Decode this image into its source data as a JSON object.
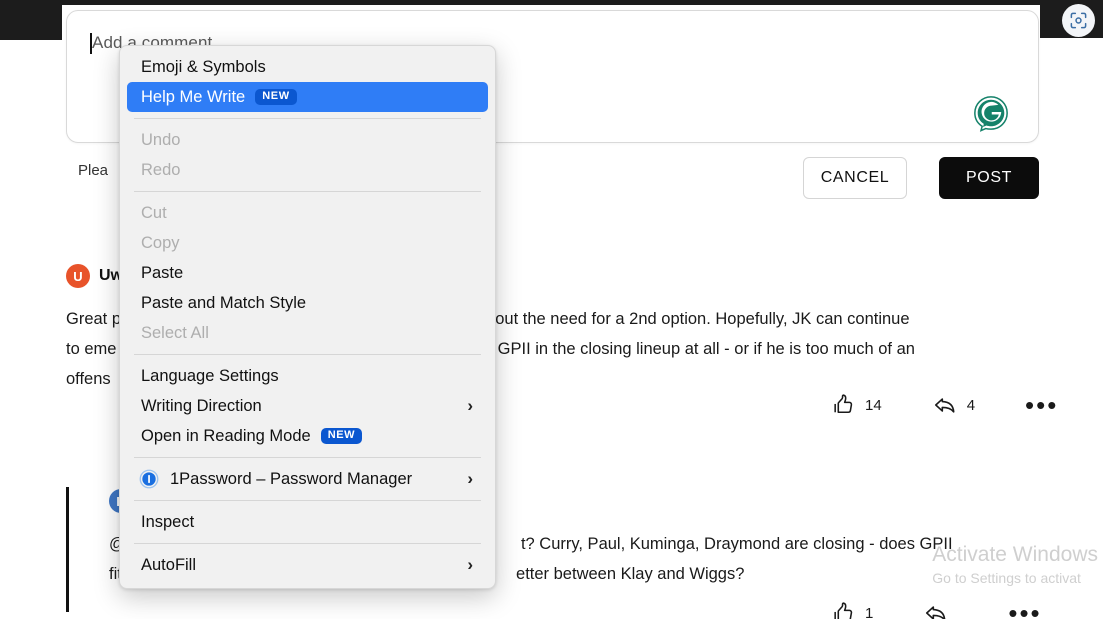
{
  "window": {
    "capture_icon": "screenshot-capture-icon"
  },
  "composer": {
    "placeholder": "Add a comment...",
    "value": "",
    "grammarly_icon": "grammarly-icon"
  },
  "action_row": {
    "hint_text": "Plea",
    "cancel_label": "CANCEL",
    "post_label": "POST"
  },
  "comments": [
    {
      "avatar_letter": "U",
      "avatar_color": "#e8532a",
      "username": "Uw",
      "body_line1_left": "Great p",
      "body_line1_right": "out the need for a 2nd option. Hopefully, JK can continue",
      "body_line2_left": "to eme",
      "body_line2_right": "GPII in the closing lineup at all - or if he is too much of an",
      "body_line3_left": "offens",
      "likes": "14",
      "replies": "4",
      "more_label": "•••"
    },
    {
      "avatar_letter": "B",
      "avatar_color": "#3f76c4",
      "username": "",
      "body_line1_left": "@",
      "body_line1_right": "t? Curry, Paul, Kuminga, Draymond are closing - does GPII",
      "body_line2_left": "fit",
      "body_line2_right": "etter between Klay and Wiggs?",
      "likes": "1",
      "replies": "",
      "more_label": "•••"
    }
  ],
  "context_menu": {
    "items": [
      {
        "label": "Emoji & Symbols",
        "state": "enabled",
        "badge": "",
        "submenu": false,
        "icon": ""
      },
      {
        "label": "Help Me Write",
        "state": "highlighted",
        "badge": "NEW",
        "submenu": false,
        "icon": ""
      },
      {
        "label": "Undo",
        "state": "disabled",
        "badge": "",
        "submenu": false,
        "icon": ""
      },
      {
        "label": "Redo",
        "state": "disabled",
        "badge": "",
        "submenu": false,
        "icon": ""
      },
      {
        "label": "Cut",
        "state": "disabled",
        "badge": "",
        "submenu": false,
        "icon": ""
      },
      {
        "label": "Copy",
        "state": "disabled",
        "badge": "",
        "submenu": false,
        "icon": ""
      },
      {
        "label": "Paste",
        "state": "enabled",
        "badge": "",
        "submenu": false,
        "icon": ""
      },
      {
        "label": "Paste and Match Style",
        "state": "enabled",
        "badge": "",
        "submenu": false,
        "icon": ""
      },
      {
        "label": "Select All",
        "state": "disabled",
        "badge": "",
        "submenu": false,
        "icon": ""
      },
      {
        "label": "Language Settings",
        "state": "enabled",
        "badge": "",
        "submenu": false,
        "icon": ""
      },
      {
        "label": "Writing Direction",
        "state": "enabled",
        "badge": "",
        "submenu": true,
        "icon": ""
      },
      {
        "label": "Open in Reading Mode",
        "state": "enabled",
        "badge": "NEW",
        "submenu": false,
        "icon": ""
      },
      {
        "label": "1Password – Password Manager",
        "state": "enabled",
        "badge": "",
        "submenu": true,
        "icon": "1password-icon"
      },
      {
        "label": "Inspect",
        "state": "enabled",
        "badge": "",
        "submenu": false,
        "icon": ""
      },
      {
        "label": "AutoFill",
        "state": "enabled",
        "badge": "",
        "submenu": true,
        "icon": ""
      }
    ],
    "submenu_chevron": "›",
    "highlight_color": "#2f7df6",
    "badge_color": "#0b57d0"
  },
  "watermark": {
    "title": "Activate Windows",
    "subtitle": "Go to Settings to activat"
  }
}
